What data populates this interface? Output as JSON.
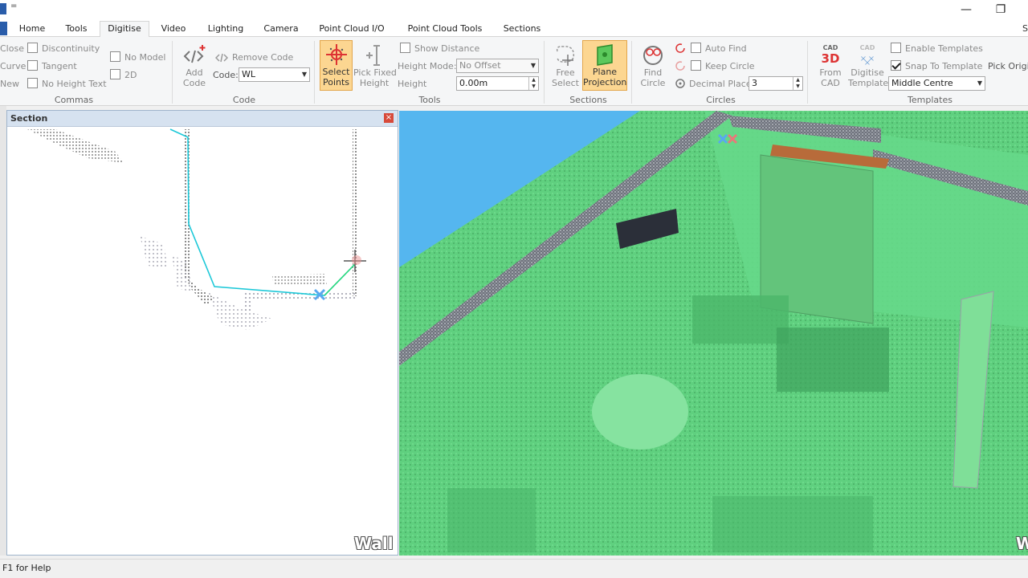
{
  "titlebar": {
    "minimize": "—",
    "restore": "❐"
  },
  "tabs": [
    {
      "label": "Home"
    },
    {
      "label": "Tools"
    },
    {
      "label": "Digitise"
    },
    {
      "label": "Video"
    },
    {
      "label": "Lighting"
    },
    {
      "label": "Camera"
    },
    {
      "label": "Point Cloud I/O"
    },
    {
      "label": "Point Cloud Tools"
    },
    {
      "label": "Sections"
    }
  ],
  "tab_overflow": "S",
  "ribbon": {
    "commas": {
      "close": "Close",
      "curve": "Curve",
      "new": "New",
      "discontinuity": "Discontinuity",
      "tangent": "Tangent",
      "no_height_text": "No Height Text",
      "no_model": "No Model",
      "two_d": "2D",
      "group": "Commas"
    },
    "code": {
      "add_code": "Add\nCode",
      "remove_code": "Remove Code",
      "code_label": "Code:",
      "code_value": "WL",
      "group": "Code"
    },
    "tools": {
      "select_points": "Select\nPoints",
      "pick_fixed_height": "Pick Fixed\nHeight",
      "show_distance": "Show Distance",
      "height_mode_label": "Height Mode:",
      "height_mode_value": "No Offset",
      "height_label": "Height",
      "height_value": "0.00m",
      "group": "Tools"
    },
    "sections": {
      "free_select": "Free\nSelect",
      "plane_projection": "Plane\nProjection",
      "group": "Sections"
    },
    "circles": {
      "find_circle": "Find\nCircle",
      "auto_find": "Auto Find",
      "keep_circle": "Keep Circle",
      "decimal_places_label": "Decimal Places",
      "decimal_places_value": "3",
      "group": "Circles"
    },
    "templates": {
      "from_cad": "From\nCAD",
      "digitise_template": "Digitise\nTemplate",
      "enable_templates": "Enable Templates",
      "snap_to_template": "Snap To Template",
      "snap_checked": true,
      "anchor_value": "Middle Centre",
      "pick_origin": "Pick Origi",
      "group": "Templates"
    }
  },
  "section_panel": {
    "title": "Section",
    "close": "×",
    "watermark": "Wall"
  },
  "view3d": {
    "watermark": "W"
  },
  "status": {
    "text": "F1 for Help"
  },
  "colors": {
    "accent": "#2a5daa",
    "highlight": "#fcd691",
    "sky": "#55b6ef",
    "wall_green": "#5fd07f",
    "trace_cyan": "#1cc8d8"
  }
}
